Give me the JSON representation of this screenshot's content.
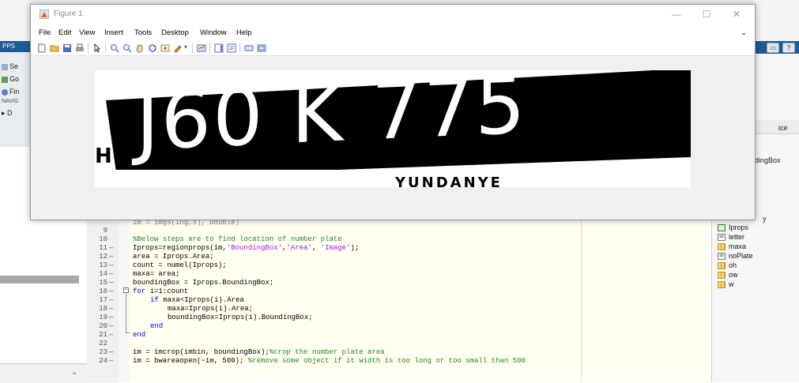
{
  "figure": {
    "title": "Figure 1",
    "menus": [
      "File",
      "Edit",
      "View",
      "Insert",
      "Tools",
      "Desktop",
      "Window",
      "Help"
    ],
    "controls": {
      "minimize": "—",
      "maximize": "☐",
      "close": "✕"
    },
    "plate": {
      "main_text": "J60 K 775",
      "left_mark": "H",
      "bottom_text": "YUNDANYE"
    }
  },
  "desktop": {
    "apps_label": "PPS",
    "left_panel": {
      "items": [
        "Se",
        "Go",
        "Fin"
      ],
      "nav_label": "NAVIG",
      "folder_item": "▸ D"
    },
    "right_panel": {
      "header_text": "ice",
      "partial_item": "dingBox",
      "partial_item2": "y",
      "variables": [
        {
          "name": "Iprops",
          "icon": "struct-icon"
        },
        {
          "name": "letter",
          "icon": "char-icon"
        },
        {
          "name": "maxa",
          "icon": "grid-icon"
        },
        {
          "name": "noPlate",
          "icon": "char-icon"
        },
        {
          "name": "oh",
          "icon": "grid-icon"
        },
        {
          "name": "ow",
          "icon": "grid-icon"
        },
        {
          "name": "w",
          "icon": "grid-icon"
        }
      ]
    }
  },
  "editor": {
    "partial_top_line": "im = imgs(ing,s), Double)",
    "lines": [
      {
        "num": "9",
        "dash": false,
        "text": ""
      },
      {
        "num": "10",
        "dash": false,
        "text": "%Below steps are to find location of number plate"
      },
      {
        "num": "11",
        "dash": true,
        "text": "Iprops=regionprops(im,'BoundingBox','Area', 'Image');"
      },
      {
        "num": "12",
        "dash": true,
        "text": "area = Iprops.Area;"
      },
      {
        "num": "13",
        "dash": true,
        "text": "count = numel(Iprops);"
      },
      {
        "num": "14",
        "dash": true,
        "text": "maxa= area;"
      },
      {
        "num": "15",
        "dash": true,
        "text": "boundingBox = Iprops.BoundingBox;"
      },
      {
        "num": "16",
        "dash": true,
        "text": "for i=1:count"
      },
      {
        "num": "17",
        "dash": true,
        "text": "if maxa<Iprops(i).Area"
      },
      {
        "num": "18",
        "dash": true,
        "text": "maxa=Iprops(i).Area;"
      },
      {
        "num": "19",
        "dash": true,
        "text": "boundingBox=Iprops(i).BoundingBox;"
      },
      {
        "num": "20",
        "dash": true,
        "text": "end"
      },
      {
        "num": "21",
        "dash": true,
        "text": "end"
      },
      {
        "num": "22",
        "dash": false,
        "text": ""
      },
      {
        "num": "23",
        "dash": true,
        "text": "im = imcrop(imbin, boundingBox);%crop the number plate area"
      },
      {
        "num": "24",
        "dash": true,
        "text": "im = bwareaopen(~im, 500); %remove some object if it width is too long or too small than 500"
      }
    ],
    "syntax": {
      "comment_10": "%Below steps are to find location of number plate",
      "l11_a": "Iprops=regionprops(im,",
      "l11_s1": "'BoundingBox'",
      "l11_b": ",",
      "l11_s2": "'Area'",
      "l11_c": ", ",
      "l11_s3": "'Image'",
      "l11_d": ");",
      "l16_kw": "for",
      "l16_rest": " i=1:count",
      "l17_kw": "if",
      "l17_rest": " maxa<Iprops(i).Area",
      "l20_kw": "end",
      "l21_kw": "end",
      "l23_code": "im = imcrop(imbin, boundingBox);",
      "l23_cmt": "%crop the number plate area",
      "l24_code": "im = bwareaopen(~im, 500); ",
      "l24_cmt": "%remove some object if it width is too long or too small than 500"
    }
  }
}
